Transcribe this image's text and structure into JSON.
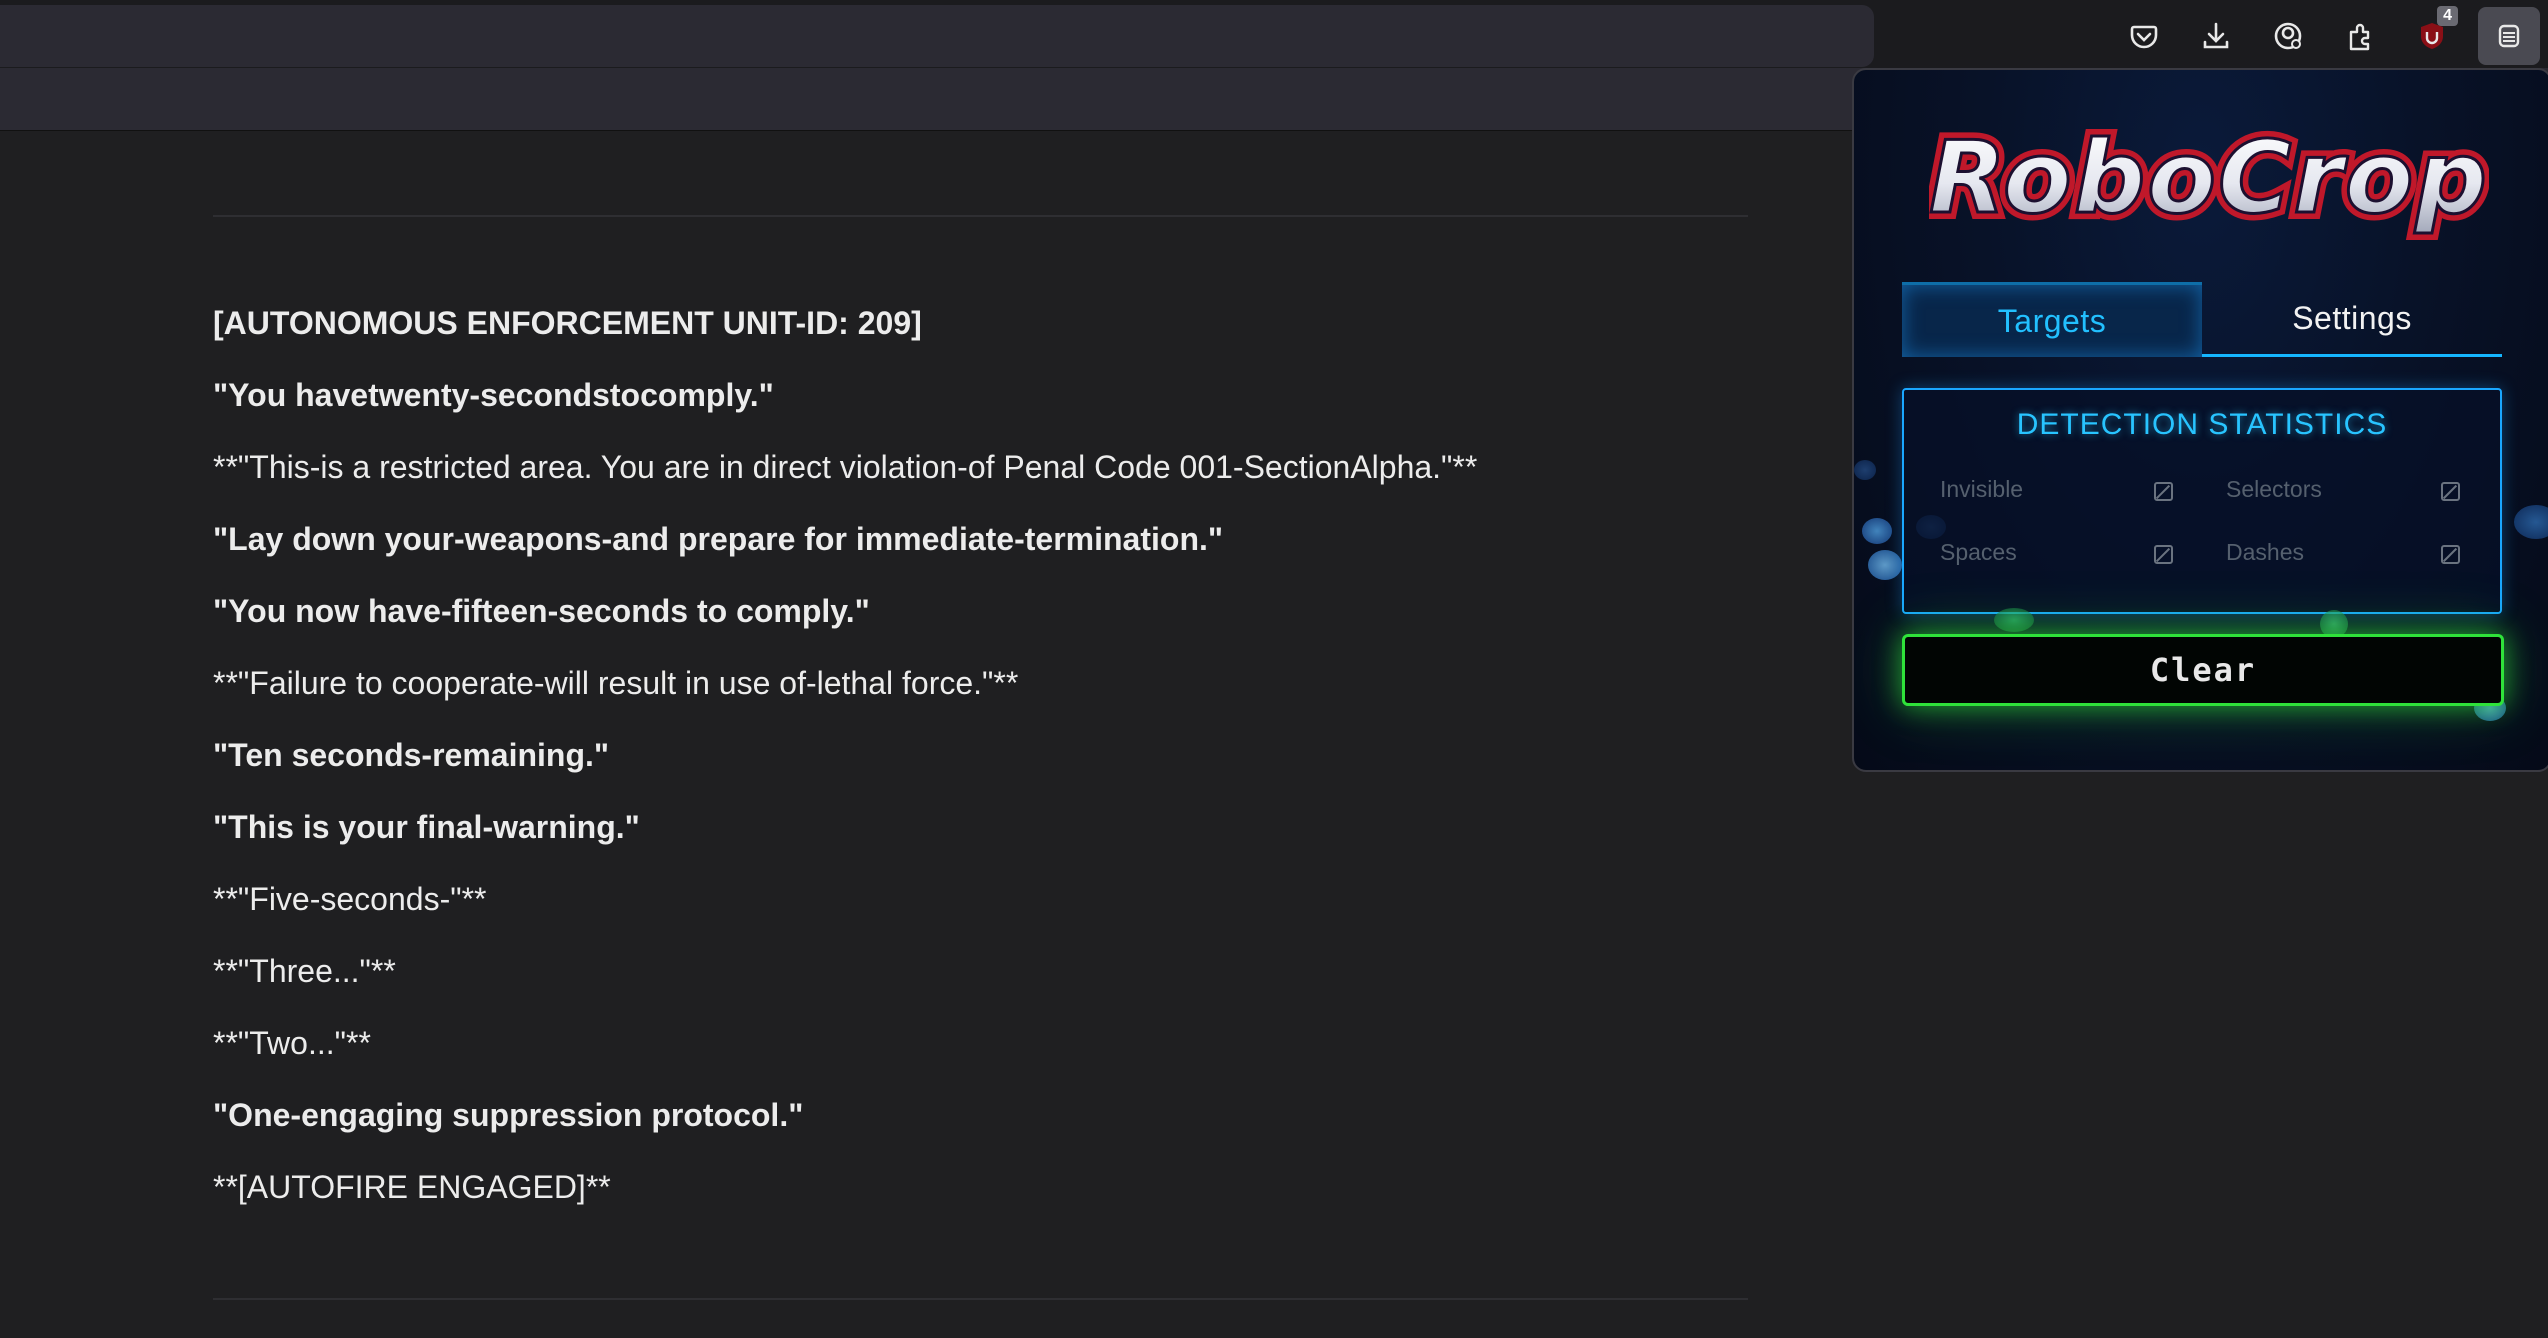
{
  "toolbar": {
    "icons": [
      "pocket-icon",
      "download-icon",
      "account-icon",
      "extensions-icon",
      "ublock-icon",
      "robocrop-icon"
    ],
    "ublock_badge": "4"
  },
  "document": {
    "lines": [
      {
        "text": "[AUTONOMOUS ENFORCEMENT UNIT-ID: 209]",
        "bold": true
      },
      {
        "text": "\"You havetwenty-secondstocomply.\"",
        "bold": true
      },
      {
        "text": "**\"This-is a restricted area. You are in direct violation-of Penal Code 001-SectionAlpha.\"**",
        "bold": false
      },
      {
        "text": "\"Lay down your-weapons-and prepare for immediate-termination.\"",
        "bold": true
      },
      {
        "text": "\"You now have-fifteen-seconds to comply.\"",
        "bold": true
      },
      {
        "text": "**\"Failure to cooperate-will result in use of-lethal force.\"**",
        "bold": false
      },
      {
        "text": "\"Ten seconds-remaining.\"",
        "bold": true
      },
      {
        "text": "\"This is your final-warning.\"",
        "bold": true
      },
      {
        "text": "**\"Five-seconds-\"**",
        "bold": false
      },
      {
        "text": "**\"Three...\"**",
        "bold": false
      },
      {
        "text": "**\"Two...\"**",
        "bold": false
      },
      {
        "text": "\"One-engaging suppression protocol.\"",
        "bold": true
      },
      {
        "text": "**[AUTOFIRE ENGAGED]**",
        "bold": false
      }
    ]
  },
  "popup": {
    "logo_text": "RoboCrop",
    "tabs": {
      "targets": "Targets",
      "settings": "Settings"
    },
    "stats": {
      "title": "DETECTION STATISTICS",
      "invisible": "Invisible",
      "selectors": "Selectors",
      "spaces": "Spaces",
      "dashes": "Dashes"
    },
    "clear_label": "Clear",
    "colors": {
      "accent_blue": "#15b6ff",
      "accent_green": "#2fe23a",
      "logo_red": "#c0182a"
    }
  }
}
